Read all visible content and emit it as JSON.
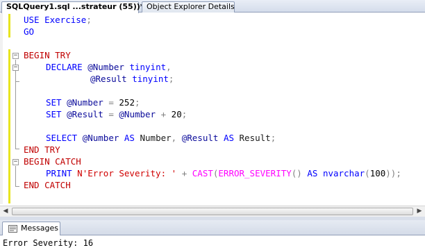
{
  "tabs": [
    {
      "label": "SQLQuery1.sql ...strateur (55))*",
      "active": true
    },
    {
      "label": "Object Explorer Details",
      "active": false
    }
  ],
  "code": {
    "l1": [
      "USE",
      " ",
      "Exercise",
      ";"
    ],
    "l2": [
      "GO"
    ],
    "l4": [
      "BEGIN TRY"
    ],
    "l5": [
      "DECLARE",
      " ",
      "@Number",
      " ",
      "tinyint",
      ","
    ],
    "l6": [
      "@Result",
      " ",
      "tinyint",
      ";"
    ],
    "l8": [
      "SET",
      " ",
      "@Number",
      " ",
      "=",
      " ",
      "252",
      ";"
    ],
    "l9": [
      "SET",
      " ",
      "@Result",
      " ",
      "=",
      " ",
      "@Number",
      " ",
      "+",
      " ",
      "20",
      ";"
    ],
    "l11": [
      "SELECT",
      " ",
      "@Number",
      " ",
      "AS",
      " ",
      "Number",
      ", ",
      "@Result",
      " ",
      "AS",
      " ",
      "Result",
      ";"
    ],
    "l12": [
      "END TRY"
    ],
    "l13": [
      "BEGIN CATCH"
    ],
    "l14": [
      "PRINT",
      " ",
      "N'Error Severity: '",
      " ",
      "+",
      " ",
      "CAST",
      "(",
      "ERROR_SEVERITY",
      "()",
      " ",
      "AS",
      " ",
      "nvarchar",
      "(",
      "100",
      "));"
    ],
    "l15": [
      "END CATCH"
    ]
  },
  "results": {
    "tab_label": "Messages",
    "message": "Error Severity: 16"
  },
  "colors": {
    "keyword": "#0000ff",
    "block_keyword": "#c00000",
    "string": "#d00000",
    "function": "#ff00ff",
    "change_bar": "#e7e41f"
  }
}
